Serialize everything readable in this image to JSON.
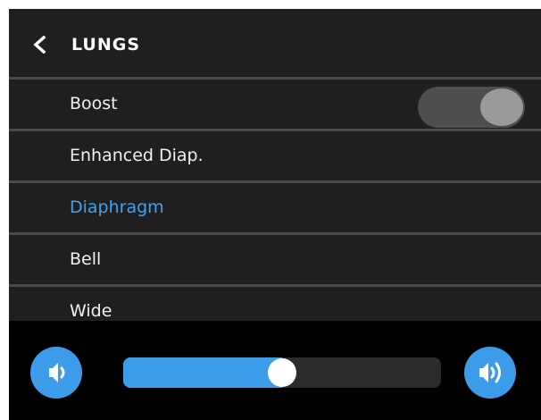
{
  "header": {
    "title": "LUNGS"
  },
  "menu": {
    "items": [
      {
        "label": "Boost",
        "has_toggle": true,
        "active": false
      },
      {
        "label": "Enhanced Diap.",
        "has_toggle": false,
        "active": false
      },
      {
        "label": "Diaphragm",
        "has_toggle": false,
        "active": true
      },
      {
        "label": "Bell",
        "has_toggle": false,
        "active": false
      },
      {
        "label": "Wide",
        "has_toggle": false,
        "active": false
      }
    ]
  },
  "boost_toggle": {
    "on": true
  },
  "volume": {
    "level_percent": 50
  },
  "colors": {
    "accent": "#3d9cea",
    "row_background": "#1f1f1f",
    "divider": "#4a4a4a",
    "toggle_track": "#4e4e4e",
    "toggle_knob": "#9a9a9a"
  },
  "icons": {
    "back": "chevron-left-icon",
    "volume_down": "volume-low-icon",
    "volume_up": "volume-high-icon"
  }
}
